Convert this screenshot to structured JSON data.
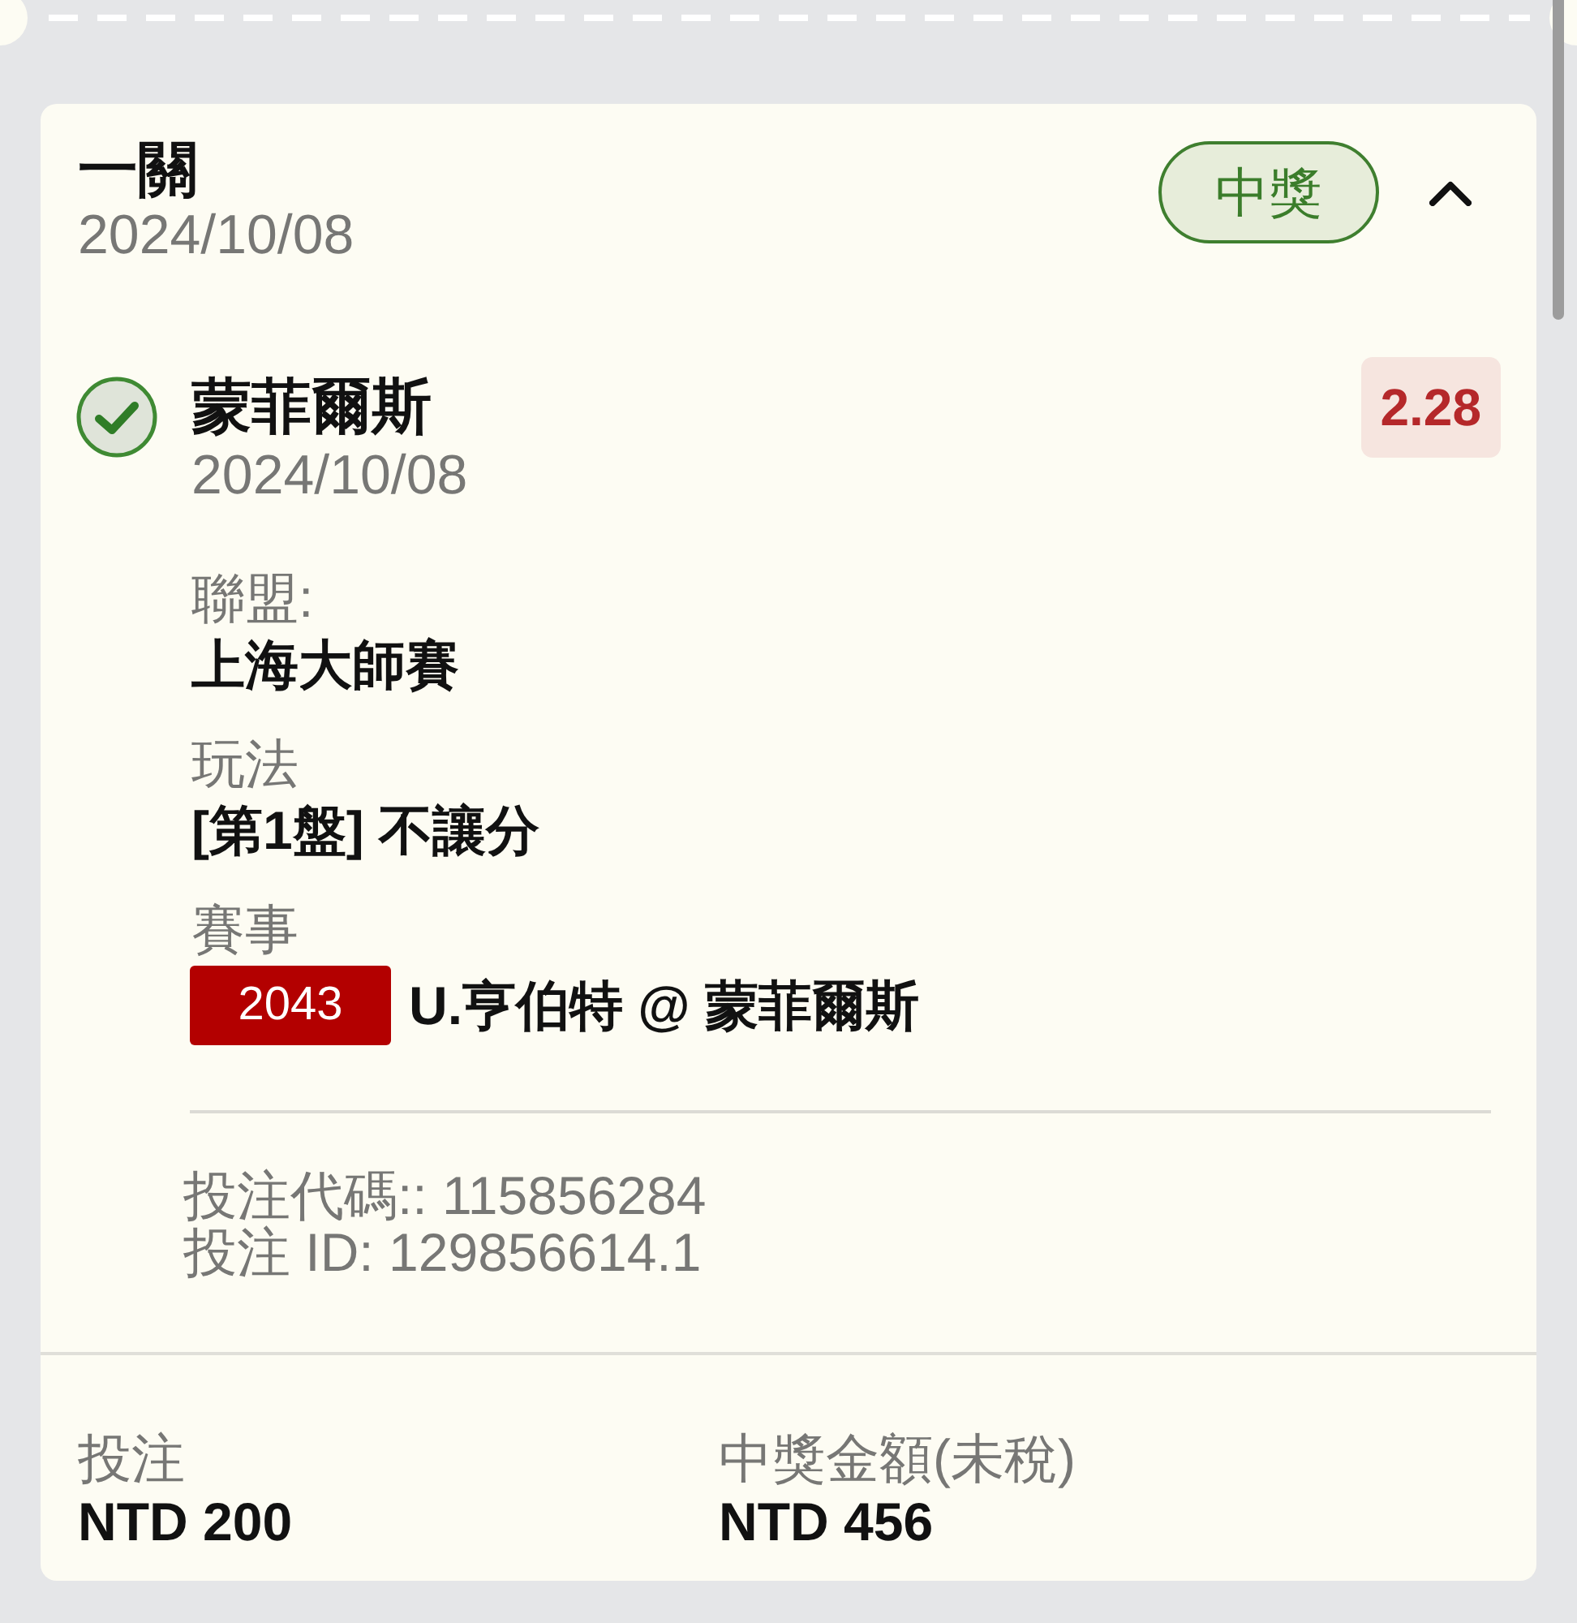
{
  "bet": {
    "type": "一關",
    "date": "2024/10/08",
    "status": "中獎",
    "expanded": true
  },
  "selection": {
    "won": true,
    "name": "蒙菲爾斯",
    "date": "2024/10/08",
    "odds": "2.28",
    "details": [
      {
        "kind": "text",
        "label": "聯盟:",
        "value": "上海大師賽"
      },
      {
        "kind": "text",
        "label": "玩法",
        "value": "[第1盤] 不讓分"
      },
      {
        "kind": "match",
        "label": "賽事",
        "tag": "2043",
        "value": "U.亨伯特 @ 蒙菲爾斯"
      }
    ]
  },
  "codes": [
    "投注代碼:: 115856284",
    "投注 ID: 129856614.1"
  ],
  "summary": [
    {
      "label": "投注",
      "value": "NTD 200"
    },
    {
      "label": "中獎金額(未稅)",
      "value": "NTD 456"
    }
  ]
}
